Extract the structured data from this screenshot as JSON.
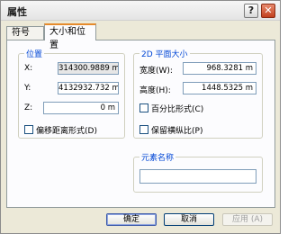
{
  "window": {
    "title": "属性",
    "help_label": "?",
    "close_label": "✕"
  },
  "tabs": [
    {
      "label": "符号",
      "active": false
    },
    {
      "label": "大小和位置",
      "active": true
    }
  ],
  "position_group": {
    "title": "位置",
    "x_label": "X:",
    "x_value": "314300.9889 m",
    "y_label": "Y:",
    "y_value": "4132932.732 m",
    "z_label": "Z:",
    "z_value": "0 m",
    "offset_checkbox_label": "偏移距离形式(D)"
  },
  "size_group": {
    "title": "2D 平面大小",
    "width_label": "宽度(W):",
    "width_value": "968.3281 m",
    "height_label": "高度(H):",
    "height_value": "1448.5325 m",
    "percent_checkbox_label": "百分比形式(C)",
    "aspect_checkbox_label": "保留横纵比(P)"
  },
  "name_group": {
    "title": "元素名称",
    "value": ""
  },
  "buttons": {
    "ok": "确定",
    "cancel": "取消",
    "apply": "应用 (A)"
  },
  "colors": {
    "group_title": "#0046d5",
    "active_tab_accent": "#e68b2c",
    "close_button": "#c2401e"
  }
}
